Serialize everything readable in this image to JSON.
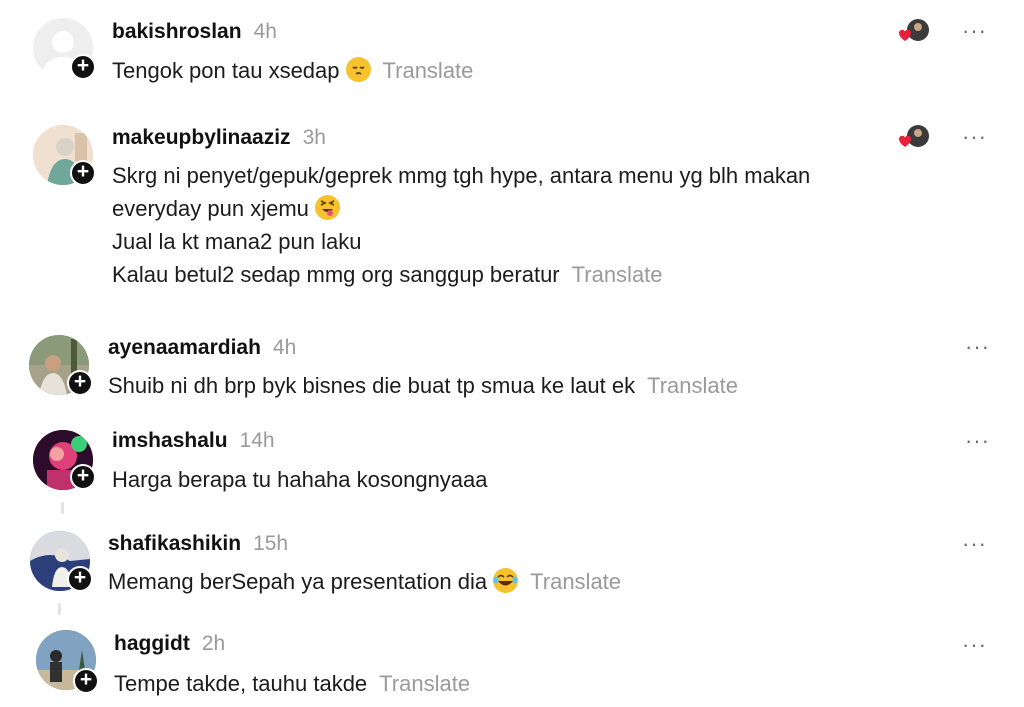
{
  "comments": [
    {
      "username": "bakishroslan",
      "time": "4h",
      "lines": [
        "Tengok pon tau xsedap"
      ],
      "emoji": "pensive-face",
      "translate": "Translate",
      "author_liked": true
    },
    {
      "username": "makeupbylinaaziz",
      "time": "3h",
      "lines": [
        "Skrg ni penyet/gepuk/geprek mmg tgh hype, antara menu yg blh makan",
        "everyday pun xjemu",
        "Jual la kt mana2 pun laku",
        "Kalau betul2 sedap mmg org sanggup beratur"
      ],
      "emoji": "face-savoring-food",
      "translate": "Translate",
      "author_liked": true
    },
    {
      "username": "ayenaamardiah",
      "time": "4h",
      "lines": [
        "Shuib ni dh brp byk bisnes die buat tp smua ke laut ek"
      ],
      "translate": "Translate",
      "author_liked": false
    },
    {
      "username": "imshashalu",
      "time": "14h",
      "lines": [
        "Harga berapa tu hahaha kosongnyaaa"
      ],
      "author_liked": false
    },
    {
      "username": "shafikashikin",
      "time": "15h",
      "lines": [
        "Memang berSepah ya presentation dia"
      ],
      "emoji": "rolling-laughing-face",
      "translate": "Translate",
      "author_liked": false
    },
    {
      "username": "haggidt",
      "time": "2h",
      "lines": [
        "Tempe takde, tauhu takde"
      ],
      "translate": "Translate",
      "author_liked": false
    }
  ],
  "icons": {
    "follow": "+",
    "more": "···"
  },
  "colors": {
    "heart": "#e8213a",
    "meta_gray": "#9a9a9a",
    "emoji_yellow": "#f7c22d"
  }
}
